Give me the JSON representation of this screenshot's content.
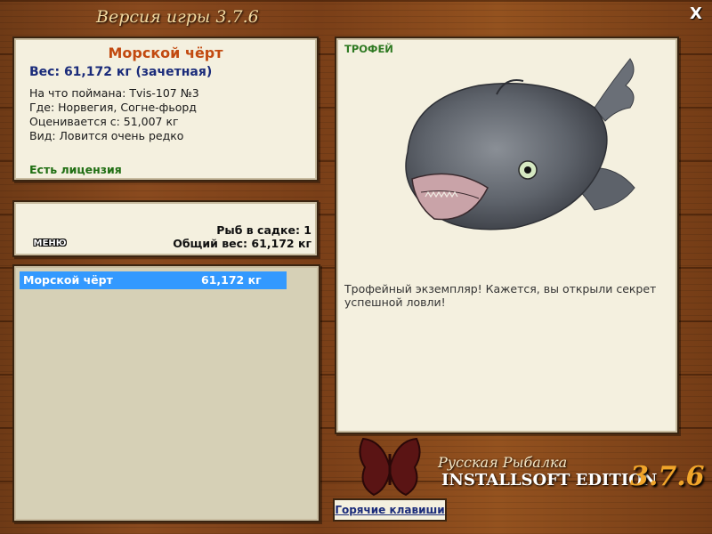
{
  "window": {
    "title": "Версия игры 3.7.6",
    "close_label": "X"
  },
  "fish_info": {
    "name": "Морской чёрт",
    "weight": "Вес: 61,172 кг (зачетная)",
    "caught_on": "На что поймана: Tvis-107 №3",
    "location": "Где: Норвегия, Согне-фьорд",
    "valued_from": "Оценивается с: 51,007 кг",
    "rarity": "Вид: Ловится очень редко",
    "license": "Есть лицензия"
  },
  "stats": {
    "menu_label": "МЕНЮ",
    "fish_count": "Рыб в садке: 1",
    "total_weight": "Общий вес: 61,172 кг"
  },
  "catch_list": [
    {
      "name": "Морской чёрт",
      "weight": "61,172 кг",
      "selected": true
    }
  ],
  "trophy": {
    "label": "ТРОФЕЙ",
    "description": "Трофейный экземпляр! Кажется, вы открыли секрет успешной ловли!"
  },
  "logo": {
    "line1": "Русская Рыбалка",
    "line2": "INSTALLSOFT EDITION",
    "version": "3.7.6"
  },
  "hotkeys_label": "Горячие клавиши",
  "colors": {
    "panel_bg": "#f4f0df",
    "selection": "#3399ff",
    "fish_name": "#c24a10",
    "weight": "#1a2b7a",
    "license": "#1f6e12",
    "trophy_label": "#2f7a23",
    "version_accent": "#f1a52a"
  }
}
